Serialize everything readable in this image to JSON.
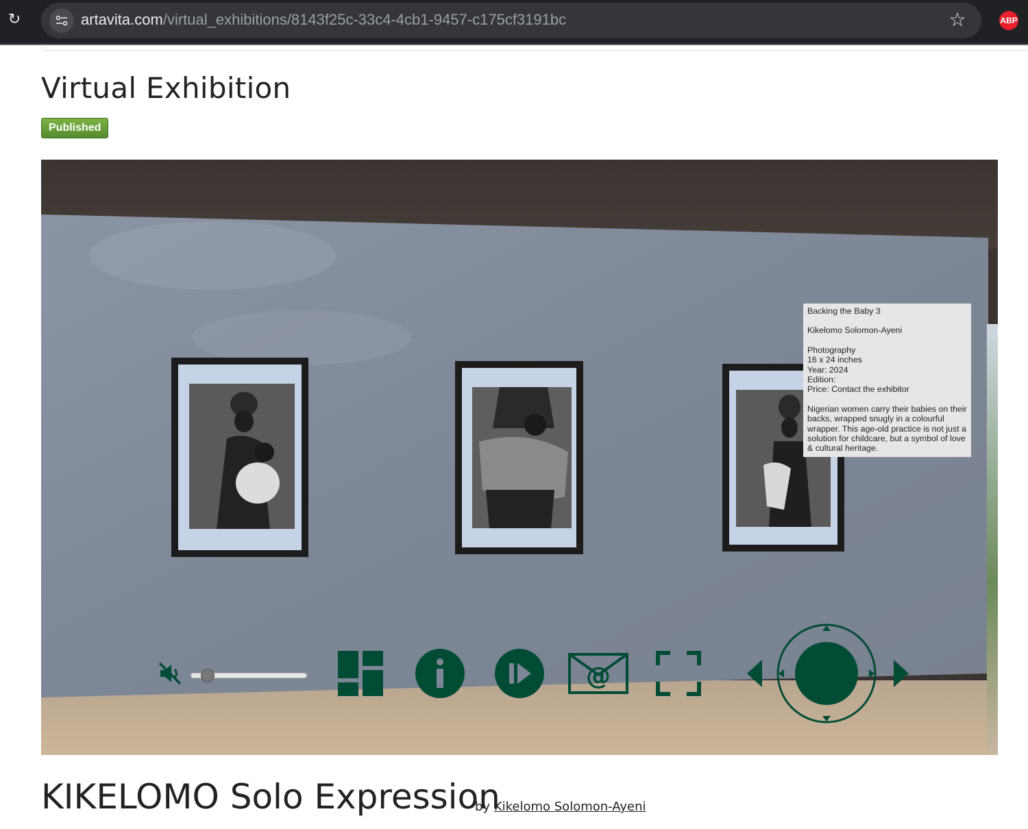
{
  "browser": {
    "url_host": "artavita.com",
    "url_path": "/virtual_exhibitions/8143f25c-33c4-4cb1-9457-c175cf3191bc",
    "extension_label": "ABP"
  },
  "page": {
    "title": "Virtual Exhibition",
    "status_badge": "Published"
  },
  "tooltip": {
    "artwork_title": "Backing the Baby 3",
    "artist": "Kikelomo Solomon-Ayeni",
    "medium": "Photography",
    "size": "16 x 24 inches",
    "year": "Year: 2024",
    "edition": "Edition:",
    "price": "Price: Contact the exhibitor",
    "description": "Nigerian women carry their babies on their backs, wrapped snugly in a colourful wrapper. This age-old practice is not just a solution for childcare, but a symbol of love & cultural heritage."
  },
  "controls": {
    "volume_level": 0.1,
    "icons": [
      "mute-icon",
      "gallery-grid-icon",
      "info-icon",
      "play-icon",
      "email-icon",
      "fullscreen-icon",
      "arrow-left-icon",
      "joystick-icon",
      "arrow-right-icon"
    ],
    "accent_color": "#024c36"
  },
  "exhibition": {
    "title": "KIKELOMO Solo Expression",
    "by": "by",
    "artist_link": "Kikelomo Solomon-Ayeni"
  }
}
